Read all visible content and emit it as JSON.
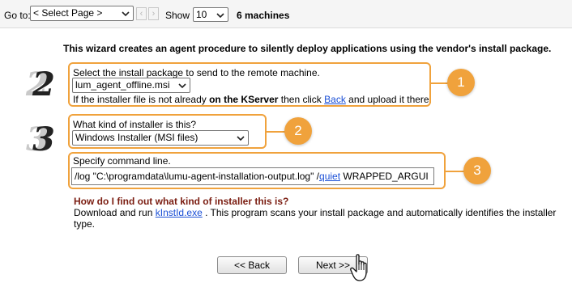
{
  "toolbar": {
    "goto_label": "Go to:",
    "page_select_value": "< Select Page >",
    "prev_icon": "‹",
    "next_icon": "›",
    "show_label": "Show",
    "show_value": "10",
    "machines_count": "6 machines"
  },
  "intro": "This wizard creates an agent procedure to silently deploy applications using the vendor's install package.",
  "steps": {
    "step2_numeral": "2",
    "step3_numeral": "3"
  },
  "package": {
    "prompt": "Select the install package to send to the remote machine.",
    "selected": "lum_agent_offline.msi",
    "note_prefix": "If the installer file is not already ",
    "note_bold": "on the KServer",
    "note_mid": " then click ",
    "note_link": "Back",
    "note_suffix": " and upload it there."
  },
  "installer": {
    "prompt": "What kind of installer is this?",
    "selected": "Windows Installer (MSI files)"
  },
  "command": {
    "prompt": "Specify command line.",
    "value_prefix": "/log \"C:\\programdata\\lumu-agent-installation-output.log\" /",
    "value_underlined": "quiet",
    "value_suffix": " WRAPPED_ARGUI"
  },
  "help": {
    "title": "How do I find out what kind of installer this is?",
    "line1_prefix": "Download and run ",
    "line1_link": "kInstId.exe",
    "line1_suffix": " . This program scans your install package and automatically identifies the installer",
    "line2": "type."
  },
  "callouts": {
    "one": "1",
    "two": "2",
    "three": "3"
  },
  "buttons": {
    "back": "<< Back",
    "next": "Next >>"
  },
  "colors": {
    "accent": "#f0a23c",
    "link": "#1a4fd6",
    "help_title": "#7a1c10"
  }
}
